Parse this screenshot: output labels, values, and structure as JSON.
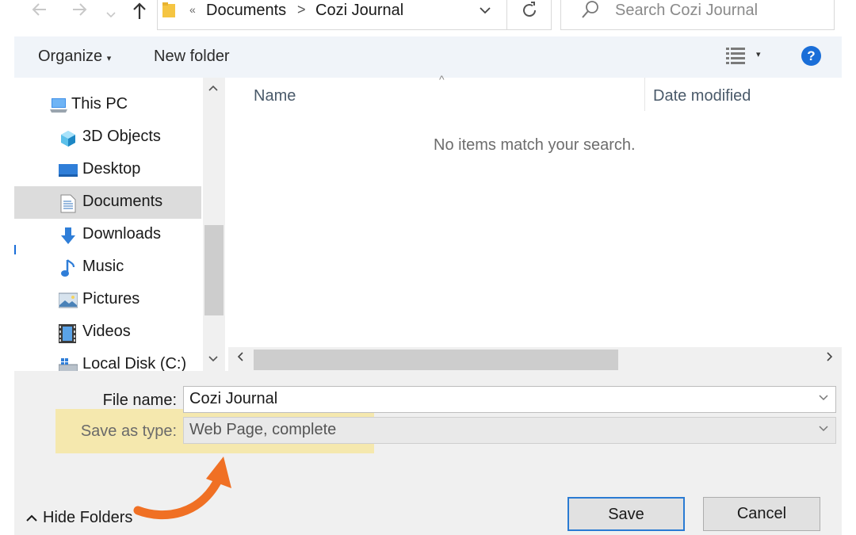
{
  "toolbar": {
    "back_icon": "back-arrow-icon",
    "forward_icon": "forward-arrow-icon",
    "recent_icon": "chevron-down-icon",
    "up_icon": "up-arrow-icon"
  },
  "address": {
    "overflow": "«",
    "segments": [
      "Documents",
      "Cozi Journal"
    ],
    "separator": ">",
    "refresh_icon": "refresh-icon"
  },
  "search": {
    "placeholder": "Search Cozi Journal",
    "icon": "search-icon"
  },
  "commands": {
    "organize": "Organize",
    "organize_caret": "▾",
    "new_folder": "New folder",
    "help": "?",
    "view_icon": "view-options-icon",
    "view_caret": "▾"
  },
  "nav_pane": {
    "items": [
      {
        "label": "This PC",
        "icon": "computer-icon"
      },
      {
        "label": "3D Objects",
        "icon": "3d-objects-icon"
      },
      {
        "label": "Desktop",
        "icon": "desktop-icon"
      },
      {
        "label": "Documents",
        "icon": "documents-icon",
        "selected": true
      },
      {
        "label": "Downloads",
        "icon": "downloads-icon"
      },
      {
        "label": "Music",
        "icon": "music-icon"
      },
      {
        "label": "Pictures",
        "icon": "pictures-icon"
      },
      {
        "label": "Videos",
        "icon": "videos-icon"
      },
      {
        "label": "Local Disk (C:)",
        "icon": "local-disk-icon"
      }
    ]
  },
  "file_list": {
    "columns": [
      "Name",
      "Date modified"
    ],
    "sort_caret": "^",
    "empty_message": "No items match your search."
  },
  "form": {
    "file_name_label": "File name:",
    "file_name_value": "Cozi Journal",
    "save_as_type_label": "Save as type:",
    "save_as_type_value": "Web Page, complete"
  },
  "footer": {
    "hide_folders": "Hide Folders",
    "save": "Save",
    "cancel": "Cancel"
  },
  "colors": {
    "accent": "#1a6ed8",
    "highlight": "#fae278",
    "annotation_arrow": "#f07024"
  }
}
